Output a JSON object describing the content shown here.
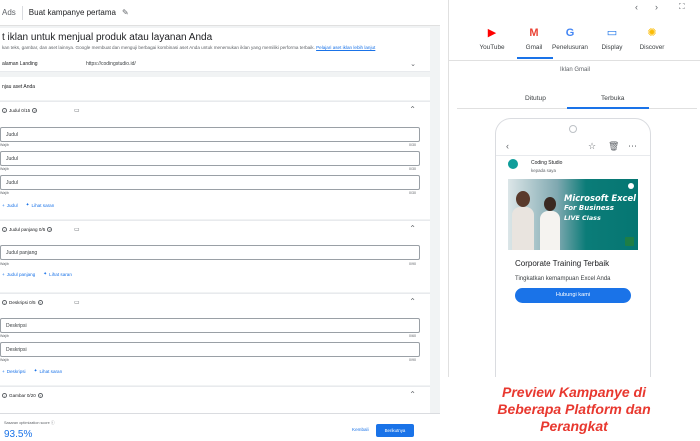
{
  "topbar": {
    "brand": "Ads",
    "campaign_title": "Buat kampanye pertama"
  },
  "intro": {
    "heading": "t iklan untuk menjual produk atau layanan Anda",
    "description": "kan teks, gambar, dan aset lainnya. Google membuat dan menguji berbagai kombinasi aset Anda untuk menemukan iklan yang memiliki performa terbaik.",
    "link": "Pelajari aset iklan lebih lanjut"
  },
  "landing": {
    "label": "alaman Landing",
    "url": "https://codingstudio.id/"
  },
  "asset_header": "njau aset Anda",
  "headlines_section": {
    "title": "Judul 0/15",
    "fields": [
      {
        "placeholder": "Judul",
        "meta_left": "Wajib",
        "meta_right": "0/30"
      },
      {
        "placeholder": "Judul",
        "meta_left": "Wajib",
        "meta_right": "0/30"
      },
      {
        "placeholder": "Judul",
        "meta_left": "Wajib",
        "meta_right": "0/30"
      }
    ],
    "add_label": "Judul",
    "ideas_label": "Lihat saran"
  },
  "long_headline_section": {
    "title": "Judul panjang 0/5",
    "fields": [
      {
        "placeholder": "Judul panjang",
        "meta_left": "Wajib",
        "meta_right": "0/90"
      }
    ],
    "add_label": "Judul panjang",
    "ideas_label": "Lihat saran"
  },
  "description_section": {
    "title": "Deskripsi 0/5",
    "fields": [
      {
        "placeholder": "Deskripsi",
        "meta_left": "Wajib",
        "meta_right": "0/60"
      },
      {
        "placeholder": "Deskripsi",
        "meta_left": "Wajib",
        "meta_right": "0/90"
      }
    ],
    "add_label": "Deskripsi",
    "ideas_label": "Lihat saran"
  },
  "images_section": {
    "title": "Gambar 0/20"
  },
  "footer": {
    "optimization_label": "Sasaran optimization score",
    "score": "93.5%",
    "back_label": "Kembali",
    "next_label": "Berikutnya"
  },
  "preview": {
    "platforms": [
      {
        "name": "YouTube",
        "icon": "youtube-icon",
        "color": "#ff0000"
      },
      {
        "name": "Gmail",
        "icon": "gmail-icon",
        "color": "#ea4335"
      },
      {
        "name": "Penelusuran",
        "icon": "google-icon",
        "color": "#4285f4"
      },
      {
        "name": "Display",
        "icon": "display-icon",
        "color": "#1a73e8"
      },
      {
        "name": "Discover",
        "icon": "discover-icon",
        "color": "#fbbc04"
      }
    ],
    "selected_platform": "Gmail",
    "ad_type": "Iklan Gmail",
    "tabs": [
      "Ditutup",
      "Terbuka"
    ],
    "selected_tab": "Terbuka",
    "email": {
      "sender": "Coding Studio",
      "to": "kepada saya",
      "banner_lines": [
        "Microsoft Excel",
        "For Business",
        "LIVE Class"
      ],
      "headline": "Corporate Training Terbaik",
      "description": "Tingkatkan kemampuan Excel Anda",
      "cta": "Hubungi kami"
    }
  },
  "promo": {
    "lines": [
      "Preview Kampanye di",
      "Beberapa Platform dan",
      "Perangkat"
    ]
  },
  "colors": {
    "accent": "#1a73e8",
    "promo_red": "#e8382f"
  }
}
